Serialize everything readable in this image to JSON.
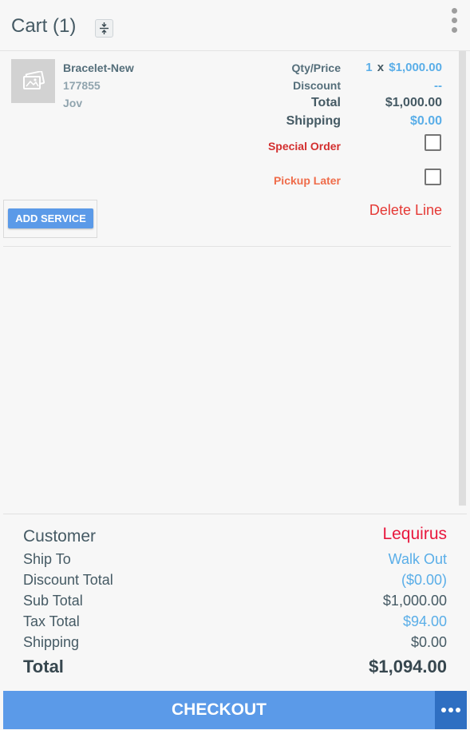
{
  "header": {
    "title": "Cart (1)",
    "collapse_icon": "collapse-vertical-icon",
    "menu_icon": "kebab-menu-icon"
  },
  "line_item": {
    "image_icon": "image-placeholder-icon",
    "name": "Bracelet-New",
    "sku": "177855",
    "vendor": "Jov",
    "labels": {
      "qty_price": "Qty/Price",
      "discount": "Discount",
      "total": "Total",
      "shipping": "Shipping",
      "special_order": "Special Order",
      "pickup_later": "Pickup Later"
    },
    "qty": "1",
    "times": "x",
    "price": "$1,000.00",
    "discount": "--",
    "total": "$1,000.00",
    "shipping": "$0.00",
    "special_order_checked": false,
    "pickup_later_checked": false,
    "add_service_label": "ADD SERVICE",
    "delete_label": "Delete Line"
  },
  "summary": {
    "customer_label": "Customer",
    "customer_value": "Lequirus",
    "ship_to_label": "Ship To",
    "ship_to_value": "Walk Out",
    "discount_total_label": "Discount Total",
    "discount_total_value": "($0.00)",
    "sub_total_label": "Sub Total",
    "sub_total_value": "$1,000.00",
    "tax_total_label": "Tax Total",
    "tax_total_value": "$94.00",
    "shipping_label": "Shipping",
    "shipping_value": "$0.00",
    "total_label": "Total",
    "total_value": "$1,094.00"
  },
  "footer": {
    "checkout_label": "CHECKOUT",
    "more_icon": "more-horizontal-icon"
  },
  "colors": {
    "accent_blue": "#5b9ae8",
    "link_blue": "#5aaee8",
    "danger_red": "#e53935",
    "customer_red": "#e8173d",
    "text_dark": "#455a64"
  }
}
